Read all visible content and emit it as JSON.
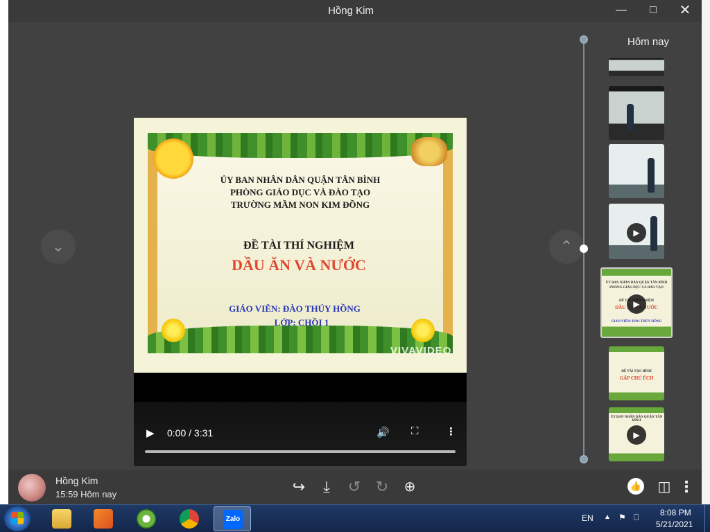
{
  "window": {
    "title": "Hồng Kim"
  },
  "slide": {
    "line1": "ỦY BAN NHÂN DÂN QUẬN TÂN BÌNH",
    "line2": "PHÒNG GIÁO DỤC VÀ ĐÀO TẠO",
    "line3": "TRƯỜNG MẦM NON KIM ĐỒNG",
    "topic": "ĐỀ TÀI THÍ NGHIỆM",
    "name": "DẦU ĂN VÀ NƯỚC",
    "teacher": "GIÁO VIÊN: ĐÀO THÚY HỒNG",
    "class": "LỚP: CHỒI 1",
    "watermark": "VIVAVIDEO"
  },
  "video": {
    "time": "0:00 / 3:31",
    "progress": 0
  },
  "timeline": {
    "header": "Hôm nay",
    "thumb5": {
      "l1": "ỦY BAN NHÂN DÂN QUẬN TÂN BÌNH",
      "l2": "PHÒNG GIÁO DỤC VÀ ĐÀO TẠO",
      "l3": "ĐỀ TÀI THÍ NGHIỆM",
      "l4": "DẦU ĂN VÀ NƯỚC",
      "l5": "GIÁO VIÊN: ĐÀO THÚY HỒNG"
    },
    "thumb6": {
      "l1": "ĐỀ TÀI TẠO HÌNH",
      "l2": "GẤP CHÚ ẾCH"
    },
    "thumb7": {
      "l1": "ỦY BAN NHÂN DÂN QUẬN TÂN BÌNH"
    }
  },
  "footer": {
    "sender": "Hồng Kim",
    "time": "15:59 Hôm nay"
  },
  "tray": {
    "lang": "EN",
    "clock": "8:08 PM",
    "date": "5/21/2021"
  },
  "colors": {
    "window_bg": "#414141",
    "bar_bg": "#3a3a3a",
    "taskbar": "#1e3a66",
    "title_red": "#e0472f",
    "teacher_blue": "#2a38b8"
  }
}
